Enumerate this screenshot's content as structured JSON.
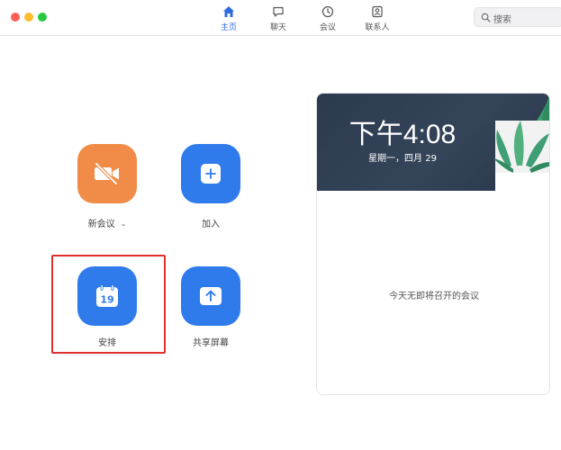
{
  "nav": {
    "home": "主页",
    "chat": "聊天",
    "meetings": "会议",
    "contacts": "联系人"
  },
  "search": {
    "placeholder": "搜索"
  },
  "actions": {
    "new_meeting": "新会议",
    "join": "加入",
    "schedule": "安排",
    "schedule_day": "19",
    "share_screen": "共享屏幕"
  },
  "card": {
    "time": "下午4:08",
    "date": "星期一，四月 29",
    "empty_message": "今天无即将召开的会议"
  },
  "colors": {
    "accent": "#2d6cdf",
    "tile_blue": "#2f7bec",
    "tile_orange": "#f08c47",
    "highlight": "#e0302e"
  }
}
